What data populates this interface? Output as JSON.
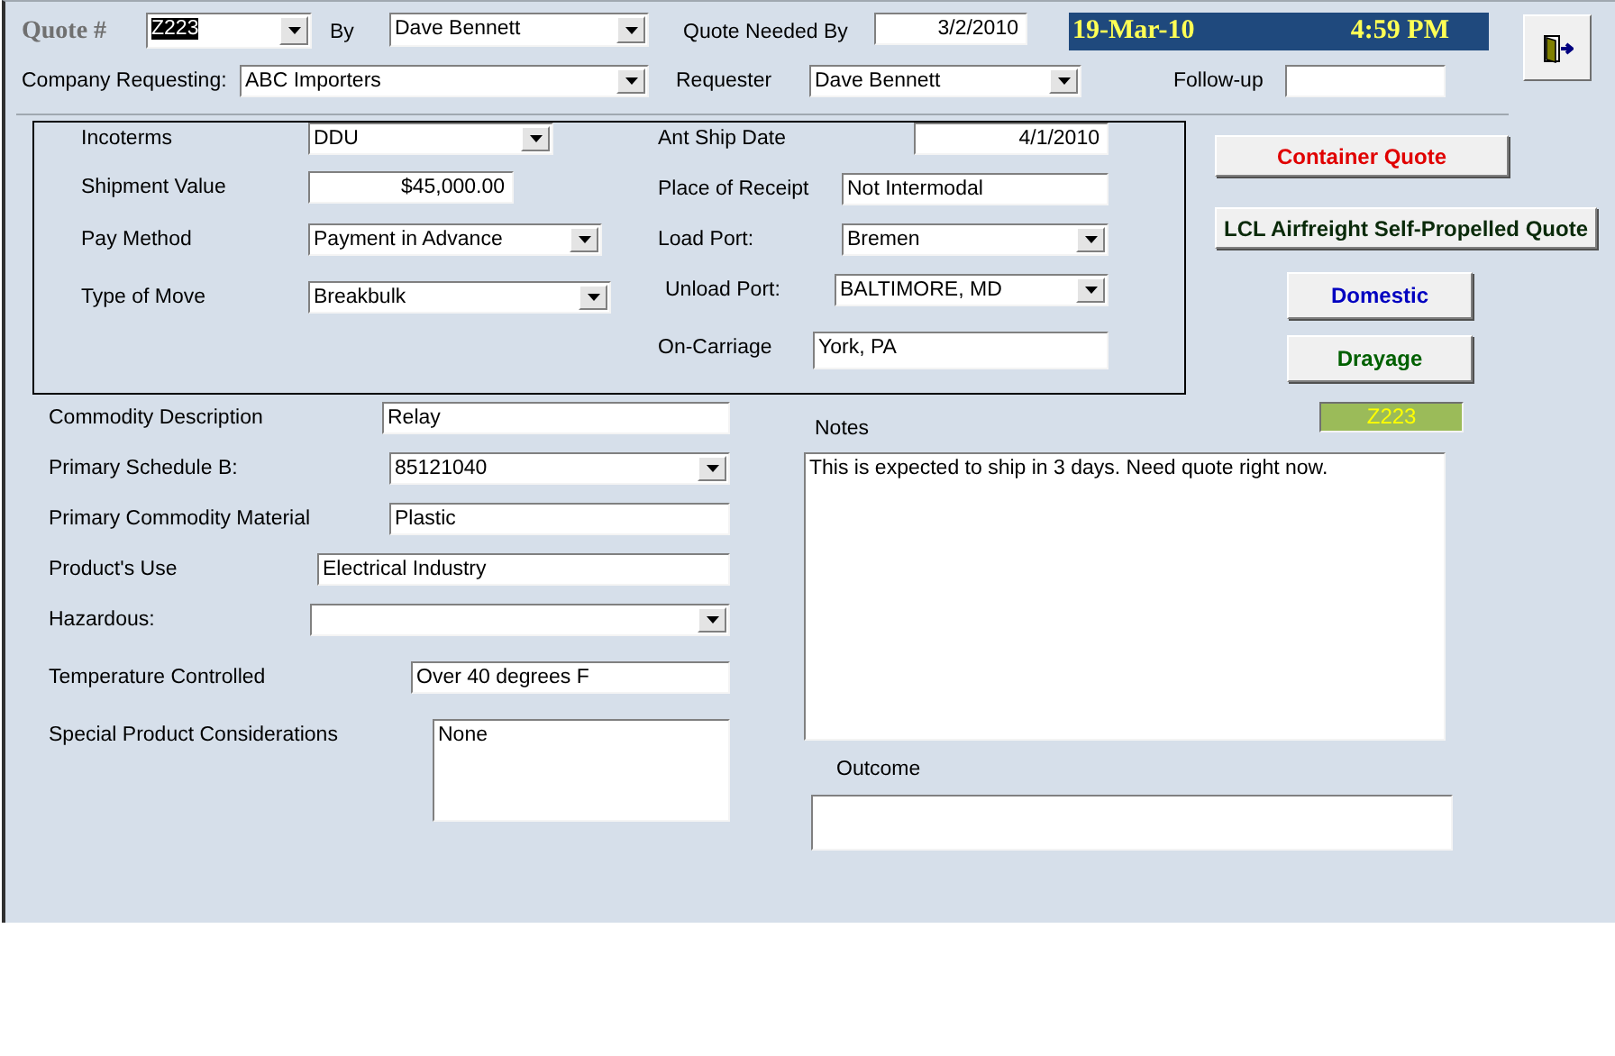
{
  "header_rows": [
    [
      {
        "kind": "title",
        "text": "Quote #"
      },
      {
        "kind": "combo",
        "value": "Z223",
        "highlighted": true
      },
      {
        "kind": "label",
        "text": "By"
      },
      {
        "kind": "combo",
        "value": "Dave Bennett"
      },
      {
        "kind": "label",
        "text": "Quote Needed By"
      },
      {
        "kind": "date",
        "value": "3/2/2010"
      },
      {
        "kind": "banner",
        "date": "19-Mar-10",
        "time": "4:59 PM"
      }
    ],
    [
      {
        "kind": "label",
        "text": "Company Requesting:"
      },
      {
        "kind": "combo",
        "value": "ABC Importers"
      },
      {
        "kind": "label",
        "text": "Requester"
      },
      {
        "kind": "combo",
        "value": "Dave Bennett"
      },
      {
        "kind": "label",
        "text": "Follow-up"
      },
      {
        "kind": "text"
      }
    ]
  ],
  "shipment_box": {
    "left": [
      {
        "label": "Incoterms",
        "field": {
          "kind": "combo",
          "value": "DDU"
        }
      },
      {
        "label": "Shipment Value",
        "field": {
          "kind": "currency",
          "value": "$45,000.00"
        }
      },
      {
        "label": "Pay Method",
        "field": {
          "kind": "combo",
          "value": "Payment in Advance"
        }
      },
      {
        "label": "Type of Move",
        "field": {
          "kind": "combo",
          "value": "Breakbulk"
        }
      }
    ],
    "right": [
      {
        "label": "Ant Ship Date",
        "field": {
          "kind": "date",
          "value": "4/1/2010"
        }
      },
      {
        "label": "Place of Receipt",
        "field": {
          "kind": "text",
          "value": "Not Intermodal"
        }
      },
      {
        "label": "Load Port:",
        "field": {
          "kind": "combo",
          "value": "Bremen"
        }
      },
      {
        "label": "Unload Port:",
        "field": {
          "kind": "combo",
          "value": "BALTIMORE, MD"
        }
      },
      {
        "label": "On-Carriage",
        "field": {
          "kind": "text",
          "value": "York, PA"
        }
      }
    ]
  },
  "actions": [
    {
      "label": "Container Quote",
      "color": "#e00000"
    },
    {
      "label": "LCL Airfreight Self-Propelled Quote",
      "color": "#0a2a0a"
    },
    {
      "label": "Domestic",
      "color": "#0000c0"
    },
    {
      "label": "Drayage",
      "color": "#006000"
    }
  ],
  "quote_badge": {
    "text": "Z223"
  },
  "commodity": [
    {
      "label": "Commodity Description",
      "field": {
        "kind": "text",
        "value": "Relay"
      }
    },
    {
      "label": "Primary Schedule B:",
      "field": {
        "kind": "combo",
        "value": "85121040"
      }
    },
    {
      "label": "Primary Commodity Material",
      "field": {
        "kind": "text",
        "value": "Plastic"
      }
    },
    {
      "label": "Product's Use",
      "field": {
        "kind": "text",
        "value": "Electrical Industry"
      }
    },
    {
      "label": "Hazardous:",
      "field": {
        "kind": "combo"
      }
    },
    {
      "label": "Temperature Controlled",
      "field": {
        "kind": "text",
        "value": "Over 40 degrees F"
      }
    },
    {
      "label": "Special Product Considerations",
      "field": {
        "kind": "memo",
        "value": "None"
      }
    }
  ],
  "notes": {
    "label": "Notes",
    "field": {
      "kind": "memo",
      "value": "This is expected to ship in 3 days. Need quote right now."
    }
  },
  "outcome": {
    "label": "Outcome",
    "field": {
      "kind": "text"
    }
  }
}
